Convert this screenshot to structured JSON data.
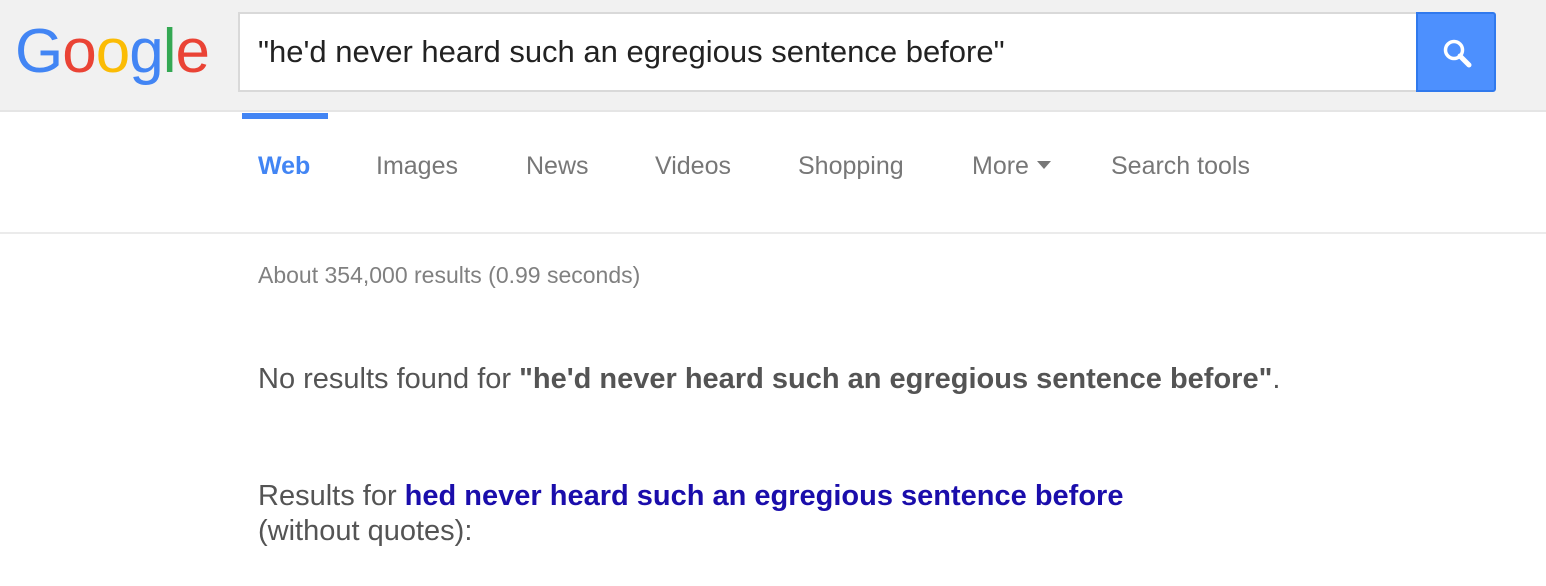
{
  "header": {
    "logo": {
      "letters": [
        "G",
        "o",
        "o",
        "g",
        "l",
        "e"
      ],
      "colors": [
        "#4285f4",
        "#ea4335",
        "#fbbc05",
        "#4285f4",
        "#34a853",
        "#ea4335"
      ]
    },
    "search": {
      "value": "\"he'd never heard such an egregious sentence before\"",
      "button_icon": "search-icon"
    }
  },
  "tabs": [
    {
      "label": "Web",
      "active": true
    },
    {
      "label": "Images",
      "active": false
    },
    {
      "label": "News",
      "active": false
    },
    {
      "label": "Videos",
      "active": false
    },
    {
      "label": "Shopping",
      "active": false
    },
    {
      "label": "More",
      "active": false,
      "icon": "chevron-down-icon"
    },
    {
      "label": "Search tools",
      "active": false
    }
  ],
  "results": {
    "stats": "About 354,000 results (0.99 seconds)",
    "no_results_prefix": "No results found for ",
    "no_results_query": "\"he'd never heard such an egregious sentence before\"",
    "no_results_suffix": ".",
    "results_for_prefix": "Results for ",
    "results_for_link": "hed never heard such an egregious sentence before",
    "results_for_suffix": "(without quotes):"
  },
  "colors": {
    "accent": "#4285f4",
    "link": "#1a0dab",
    "search_button": "#4d90fe"
  }
}
